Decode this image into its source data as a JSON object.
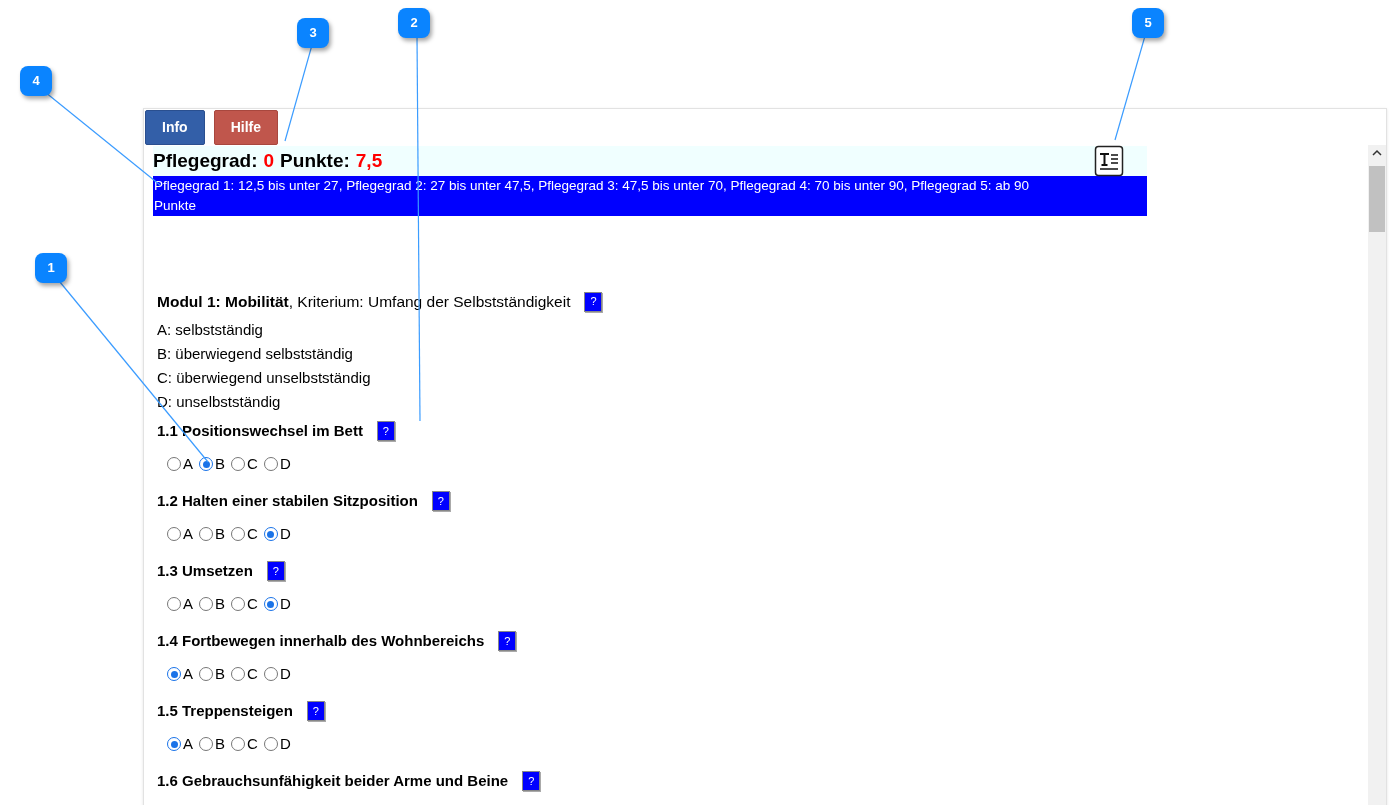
{
  "buttons": [
    {
      "label": "Info",
      "kind": "info"
    },
    {
      "label": "Hilfe",
      "kind": "help"
    }
  ],
  "score": {
    "grade_label": "Pflegegrad:",
    "grade_value": "0",
    "points_label": "Punkte:",
    "points_value": "7,5"
  },
  "legend": "Pflegegrad 1: 12,5 bis unter 27, Pflegegrad 2: 27 bis unter 47,5, Pflegegrad 3: 47,5 bis unter 70, Pflegegrad 4: 70 bis unter 90, Pflegegrad 5: ab 90 Punkte",
  "module": {
    "heading": "**Modul 1: Mobilität**, Kriterium: Umfang der Selbstständigkeit",
    "help": "?",
    "scale": [
      "A: selbstständig",
      "B: überwiegend selbstständig",
      "C: überwiegend unselbstständig",
      "D: unselbstständig"
    ]
  },
  "items": [
    {
      "label": "1.1 Positionswechsel im Bett",
      "help": "?",
      "options": [
        {
          "label": "A",
          "selected": false
        },
        {
          "label": "B",
          "selected": true
        },
        {
          "label": "C",
          "selected": false
        },
        {
          "label": "D",
          "selected": false
        }
      ]
    },
    {
      "label": "1.2 Halten einer stabilen Sitzposition",
      "help": "?",
      "options": [
        {
          "label": "A",
          "selected": false
        },
        {
          "label": "B",
          "selected": false
        },
        {
          "label": "C",
          "selected": false
        },
        {
          "label": "D",
          "selected": true
        }
      ]
    },
    {
      "label": "1.3 Umsetzen",
      "help": "?",
      "options": [
        {
          "label": "A",
          "selected": false
        },
        {
          "label": "B",
          "selected": false
        },
        {
          "label": "C",
          "selected": false
        },
        {
          "label": "D",
          "selected": true
        }
      ]
    },
    {
      "label": "1.4 Fortbewegen innerhalb des Wohnbereichs",
      "help": "?",
      "options": [
        {
          "label": "A",
          "selected": true
        },
        {
          "label": "B",
          "selected": false
        },
        {
          "label": "C",
          "selected": false
        },
        {
          "label": "D",
          "selected": false
        }
      ]
    },
    {
      "label": "1.5 Treppensteigen",
      "help": "?",
      "options": [
        {
          "label": "A",
          "selected": true
        },
        {
          "label": "B",
          "selected": false
        },
        {
          "label": "C",
          "selected": false
        },
        {
          "label": "D",
          "selected": false
        }
      ]
    },
    {
      "label": "1.6 Gebrauchsunfähigkeit beider Arme und Beine",
      "help": "?"
    }
  ],
  "callouts": [
    {
      "number": "1"
    },
    {
      "number": "2"
    },
    {
      "number": "3"
    },
    {
      "number": "4"
    },
    {
      "number": "5"
    }
  ]
}
